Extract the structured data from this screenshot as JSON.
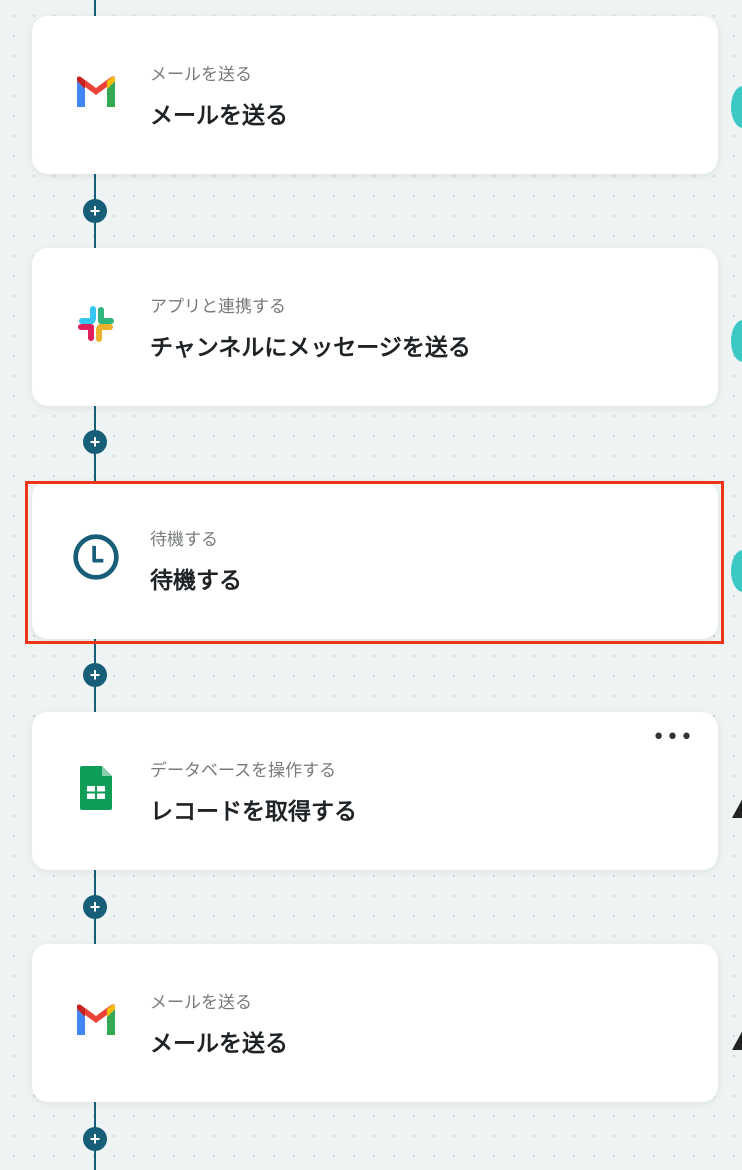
{
  "steps": [
    {
      "category": "メールを送る",
      "title": "メールを送る",
      "icon": "gmail-icon"
    },
    {
      "category": "アプリと連携する",
      "title": "チャンネルにメッセージを送る",
      "icon": "slack-icon"
    },
    {
      "category": "待機する",
      "title": "待機する",
      "icon": "clock-icon"
    },
    {
      "category": "データベースを操作する",
      "title": "レコードを取得する",
      "icon": "google-sheets-icon"
    },
    {
      "category": "メールを送る",
      "title": "メールを送る",
      "icon": "gmail-icon"
    }
  ],
  "add_step_label": "+",
  "more_menu_label": "•••",
  "colors": {
    "background": "#eef3f3",
    "connector": "#175f78",
    "highlight_border": "#f13317",
    "side_status": "#3cc8c4"
  }
}
